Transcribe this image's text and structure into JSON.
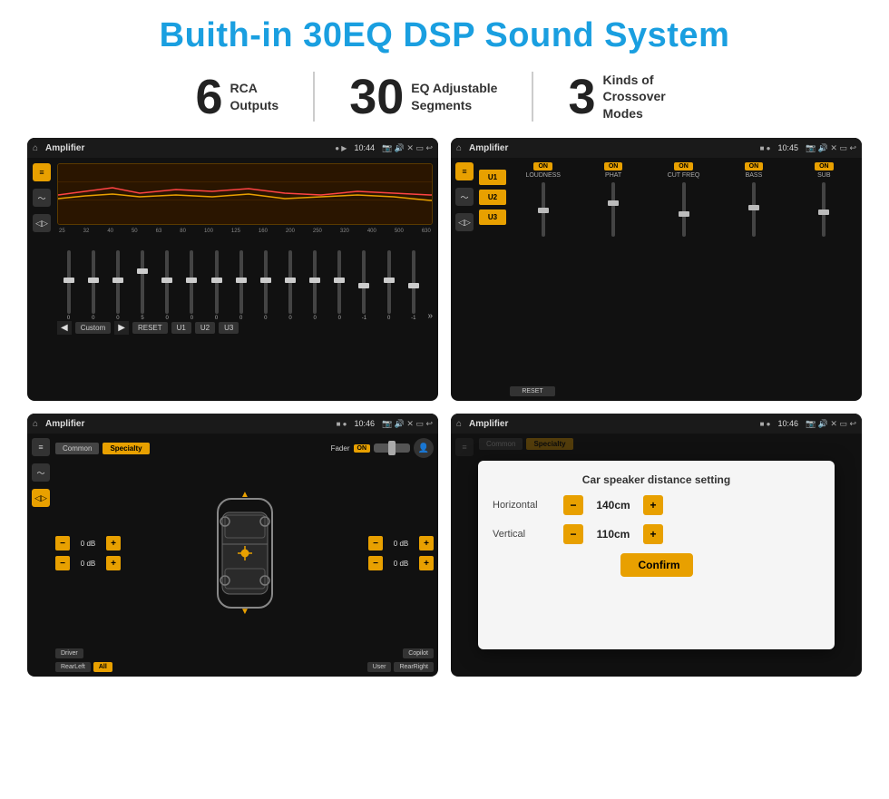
{
  "title": "Buith-in 30EQ DSP Sound System",
  "stats": [
    {
      "number": "6",
      "label": "RCA\nOutputs"
    },
    {
      "number": "30",
      "label": "EQ Adjustable\nSegments"
    },
    {
      "number": "3",
      "label": "Kinds of\nCrossover Modes"
    }
  ],
  "screens": {
    "eq": {
      "status": {
        "title": "Amplifier",
        "time": "10:44"
      },
      "freq_labels": [
        "25",
        "32",
        "40",
        "50",
        "63",
        "80",
        "100",
        "125",
        "160",
        "200",
        "250",
        "320",
        "400",
        "500",
        "630"
      ],
      "values": [
        "0",
        "0",
        "0",
        "5",
        "0",
        "0",
        "0",
        "0",
        "0",
        "0",
        "0",
        "0",
        "-1",
        "0",
        "-1"
      ],
      "buttons": [
        "Custom",
        "RESET",
        "U1",
        "U2",
        "U3"
      ]
    },
    "crossover": {
      "status": {
        "title": "Amplifier",
        "time": "10:45"
      },
      "presets": [
        "U1",
        "U2",
        "U3"
      ],
      "channels": [
        "LOUDNESS",
        "PHAT",
        "CUT FREQ",
        "BASS",
        "SUB"
      ],
      "reset": "RESET"
    },
    "fader": {
      "status": {
        "title": "Amplifier",
        "time": "10:46"
      },
      "tabs": [
        "Common",
        "Specialty"
      ],
      "fader_label": "Fader",
      "on_label": "ON",
      "controls": {
        "left_top": "0 dB",
        "left_bottom": "0 dB",
        "right_top": "0 dB",
        "right_bottom": "0 dB"
      },
      "bottom_buttons": [
        "Driver",
        "RearLeft",
        "All",
        "User",
        "Copilot",
        "RearRight"
      ]
    },
    "distance": {
      "status": {
        "title": "Amplifier",
        "time": "10:46"
      },
      "tabs": [
        "Common",
        "Specialty"
      ],
      "dialog": {
        "title": "Car speaker distance setting",
        "horizontal_label": "Horizontal",
        "horizontal_value": "140cm",
        "vertical_label": "Vertical",
        "vertical_value": "110cm",
        "confirm_label": "Confirm"
      }
    }
  }
}
